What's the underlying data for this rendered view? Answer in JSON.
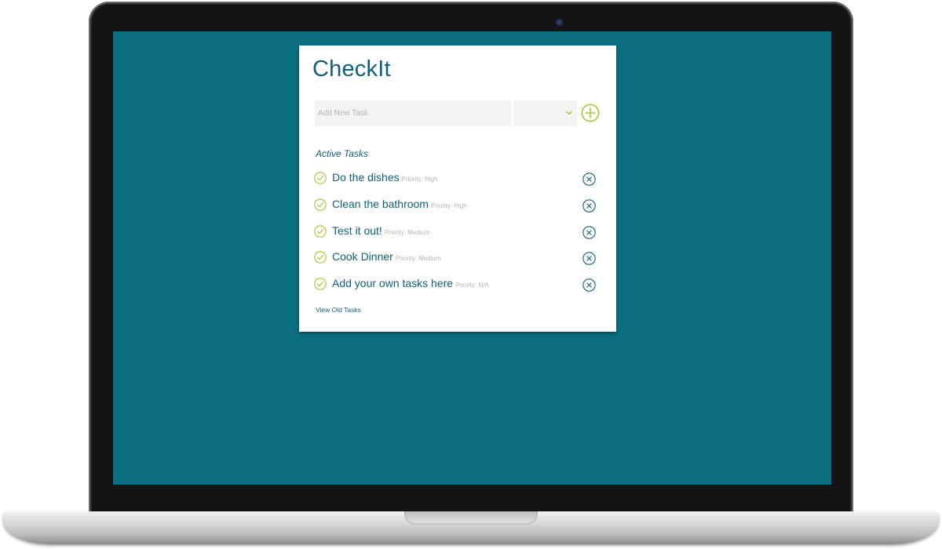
{
  "app": {
    "title": "CheckIt"
  },
  "new_task": {
    "placeholder": "Add New Task",
    "value": "",
    "priority_selected": ""
  },
  "active_tasks": {
    "heading": "Active Tasks",
    "items": [
      {
        "name": "Do the dishes",
        "priority": "Priority: High"
      },
      {
        "name": "Clean the bathroom",
        "priority": "Priority: High"
      },
      {
        "name": "Test it out!",
        "priority": "Priority: Medium"
      },
      {
        "name": "Cook Dinner",
        "priority": "Priority: Medium"
      },
      {
        "name": "Add your own tasks here",
        "priority": "Priority: N/A"
      }
    ]
  },
  "footer": {
    "view_old_label": "View Old Tasks"
  },
  "icons": {
    "add": "plus-circle-icon",
    "complete": "check-circle-icon",
    "delete": "x-circle-icon",
    "dropdown": "chevron-down-icon"
  },
  "colors": {
    "screen_background": "#0b6d80",
    "text_primary": "#10607a",
    "accent_green": "#a5c52a",
    "muted": "#b5b5b5"
  }
}
